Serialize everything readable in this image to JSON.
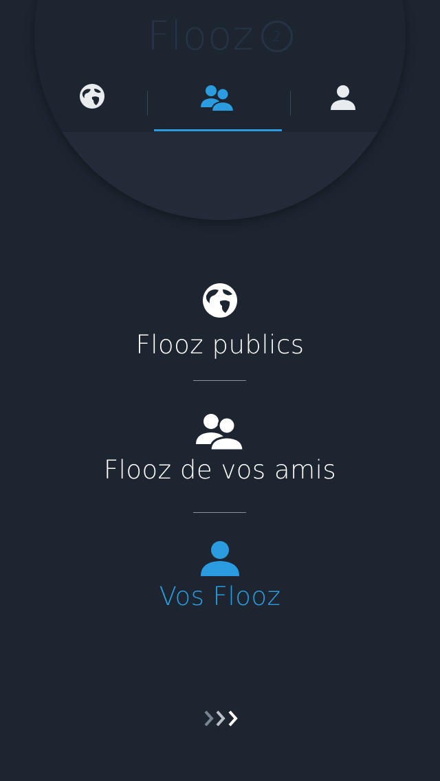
{
  "app": {
    "title": "Flooz",
    "badge_count": "2"
  },
  "tabs": [
    {
      "id": "public",
      "icon": "globe-icon",
      "active": false
    },
    {
      "id": "friends",
      "icon": "friends-icon",
      "active": true
    },
    {
      "id": "mine",
      "icon": "user-icon",
      "active": false
    }
  ],
  "menu": {
    "items": [
      {
        "label": "Flooz publics",
        "icon": "globe-icon",
        "active": false
      },
      {
        "label": "Flooz de vos amis",
        "icon": "friends-icon",
        "active": false
      },
      {
        "label": "Vos Flooz",
        "icon": "user-icon",
        "active": true
      }
    ]
  },
  "colors": {
    "background": "#1d2530",
    "accent": "#2c9ce0",
    "text": "#ffffff",
    "title": "#253345"
  },
  "footer": {
    "next_icon": "triple-chevron-right-icon"
  }
}
